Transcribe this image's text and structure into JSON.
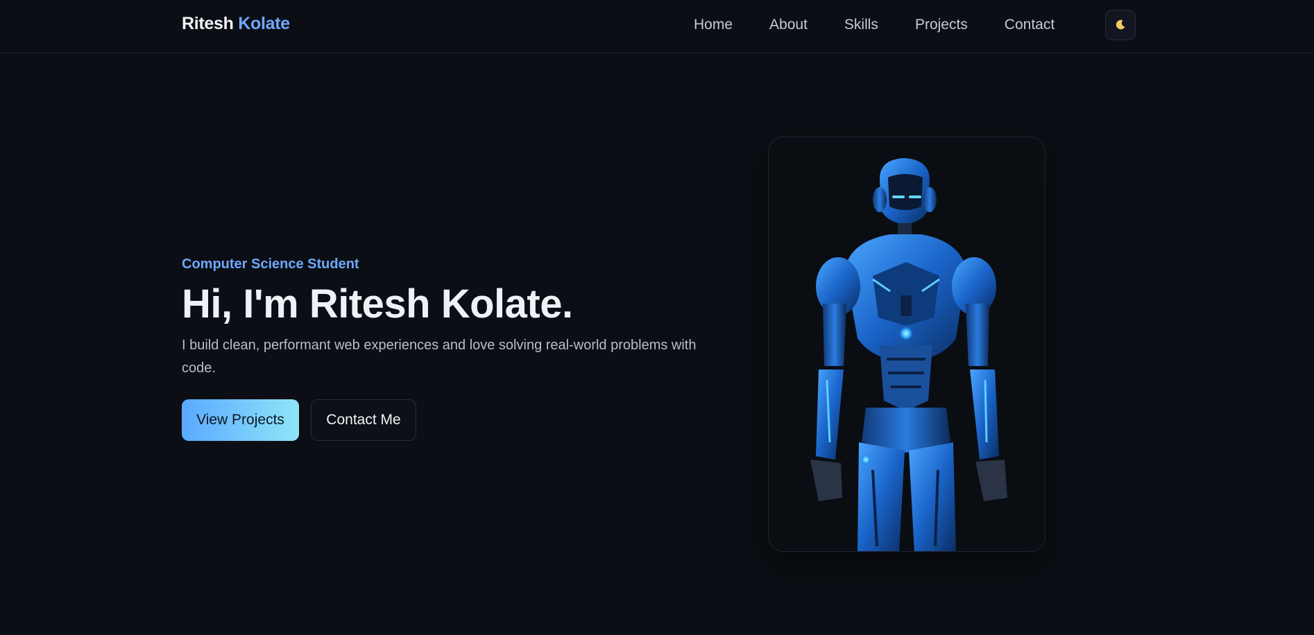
{
  "brand": {
    "first": "Ritesh",
    "last": "Kolate"
  },
  "nav": {
    "links": [
      {
        "label": "Home"
      },
      {
        "label": "About"
      },
      {
        "label": "Skills"
      },
      {
        "label": "Projects"
      },
      {
        "label": "Contact"
      }
    ],
    "theme_icon": "moon-icon"
  },
  "hero": {
    "eyebrow": "Computer Science Student",
    "headline": "Hi, I'm Ritesh Kolate.",
    "lead": "I build clean, performant web experiences and love solving real-world problems with code.",
    "primary_button": "View Projects",
    "secondary_button": "Contact Me",
    "image_icon": "robot-illustration"
  },
  "colors": {
    "background": "#0b0e14",
    "accent": "#6ea8fe",
    "gradient_start": "#5aa9ff",
    "gradient_end": "#8fe6f7"
  }
}
